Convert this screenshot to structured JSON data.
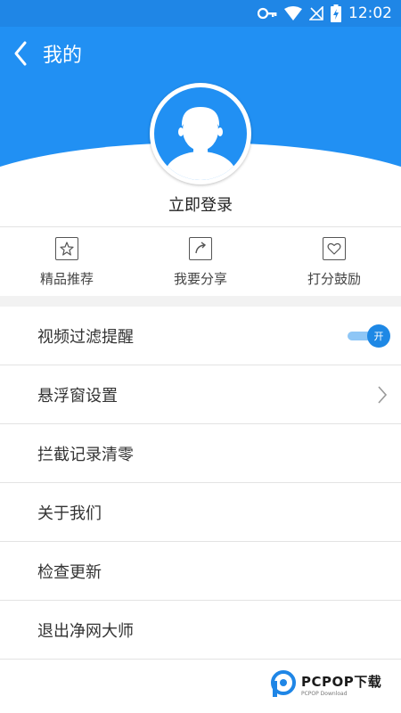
{
  "status_bar": {
    "time": "12:02",
    "icons": [
      "key-icon",
      "wifi-icon",
      "no-signal-icon",
      "battery-charging-icon"
    ]
  },
  "header": {
    "title": "我的",
    "back_icon": "chevron-left-icon",
    "color": "#2190f3"
  },
  "profile": {
    "login_label": "立即登录"
  },
  "quick_actions": [
    {
      "label": "精品推荐",
      "icon": "star-icon"
    },
    {
      "label": "我要分享",
      "icon": "share-icon"
    },
    {
      "label": "打分鼓励",
      "icon": "heart-icon"
    }
  ],
  "menu": [
    {
      "label": "视频过滤提醒",
      "control": "toggle",
      "toggle_label": "开",
      "on": true
    },
    {
      "label": "悬浮窗设置",
      "control": "chevron"
    },
    {
      "label": "拦截记录清零"
    },
    {
      "label": "关于我们"
    },
    {
      "label": "检查更新"
    },
    {
      "label": "退出净网大师"
    }
  ],
  "watermark": {
    "main": "PCPOP下载",
    "sub": "PCPOP Download"
  }
}
